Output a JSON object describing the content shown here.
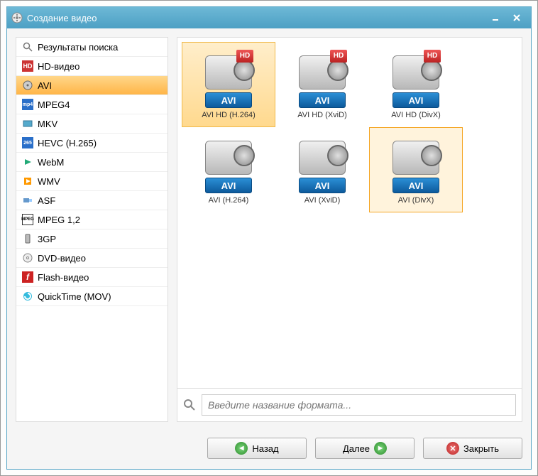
{
  "window": {
    "title": "Создание видео"
  },
  "sidebar": {
    "items": [
      {
        "label": "Результаты поиска",
        "icon": "search"
      },
      {
        "label": "HD-видео",
        "icon": "hd"
      },
      {
        "label": "AVI",
        "icon": "reel",
        "selected": true
      },
      {
        "label": "MPEG4",
        "icon": "mp4"
      },
      {
        "label": "MKV",
        "icon": "mkv"
      },
      {
        "label": "HEVC (H.265)",
        "icon": "265"
      },
      {
        "label": "WebM",
        "icon": "webm"
      },
      {
        "label": "WMV",
        "icon": "wmv"
      },
      {
        "label": "ASF",
        "icon": "asf"
      },
      {
        "label": "MPEG 1,2",
        "icon": "mpeg"
      },
      {
        "label": "3GP",
        "icon": "3gp"
      },
      {
        "label": "DVD-видео",
        "icon": "dvd"
      },
      {
        "label": "Flash-видео",
        "icon": "flash"
      },
      {
        "label": "QuickTime (MOV)",
        "icon": "qt"
      }
    ]
  },
  "formats": [
    {
      "label": "AVI HD (H.264)",
      "fmt": "AVI",
      "hd": true,
      "state": "hover"
    },
    {
      "label": "AVI HD (XviD)",
      "fmt": "AVI",
      "hd": true
    },
    {
      "label": "AVI HD (DivX)",
      "fmt": "AVI",
      "hd": true
    },
    {
      "label": "AVI (H.264)",
      "fmt": "AVI",
      "hd": false
    },
    {
      "label": "AVI (XviD)",
      "fmt": "AVI",
      "hd": false
    },
    {
      "label": "AVI (DivX)",
      "fmt": "AVI",
      "hd": false,
      "state": "selected"
    }
  ],
  "search": {
    "placeholder": "Введите название формата..."
  },
  "footer": {
    "back": "Назад",
    "next": "Далее",
    "close": "Закрыть"
  },
  "badges": {
    "hd": "HD"
  }
}
